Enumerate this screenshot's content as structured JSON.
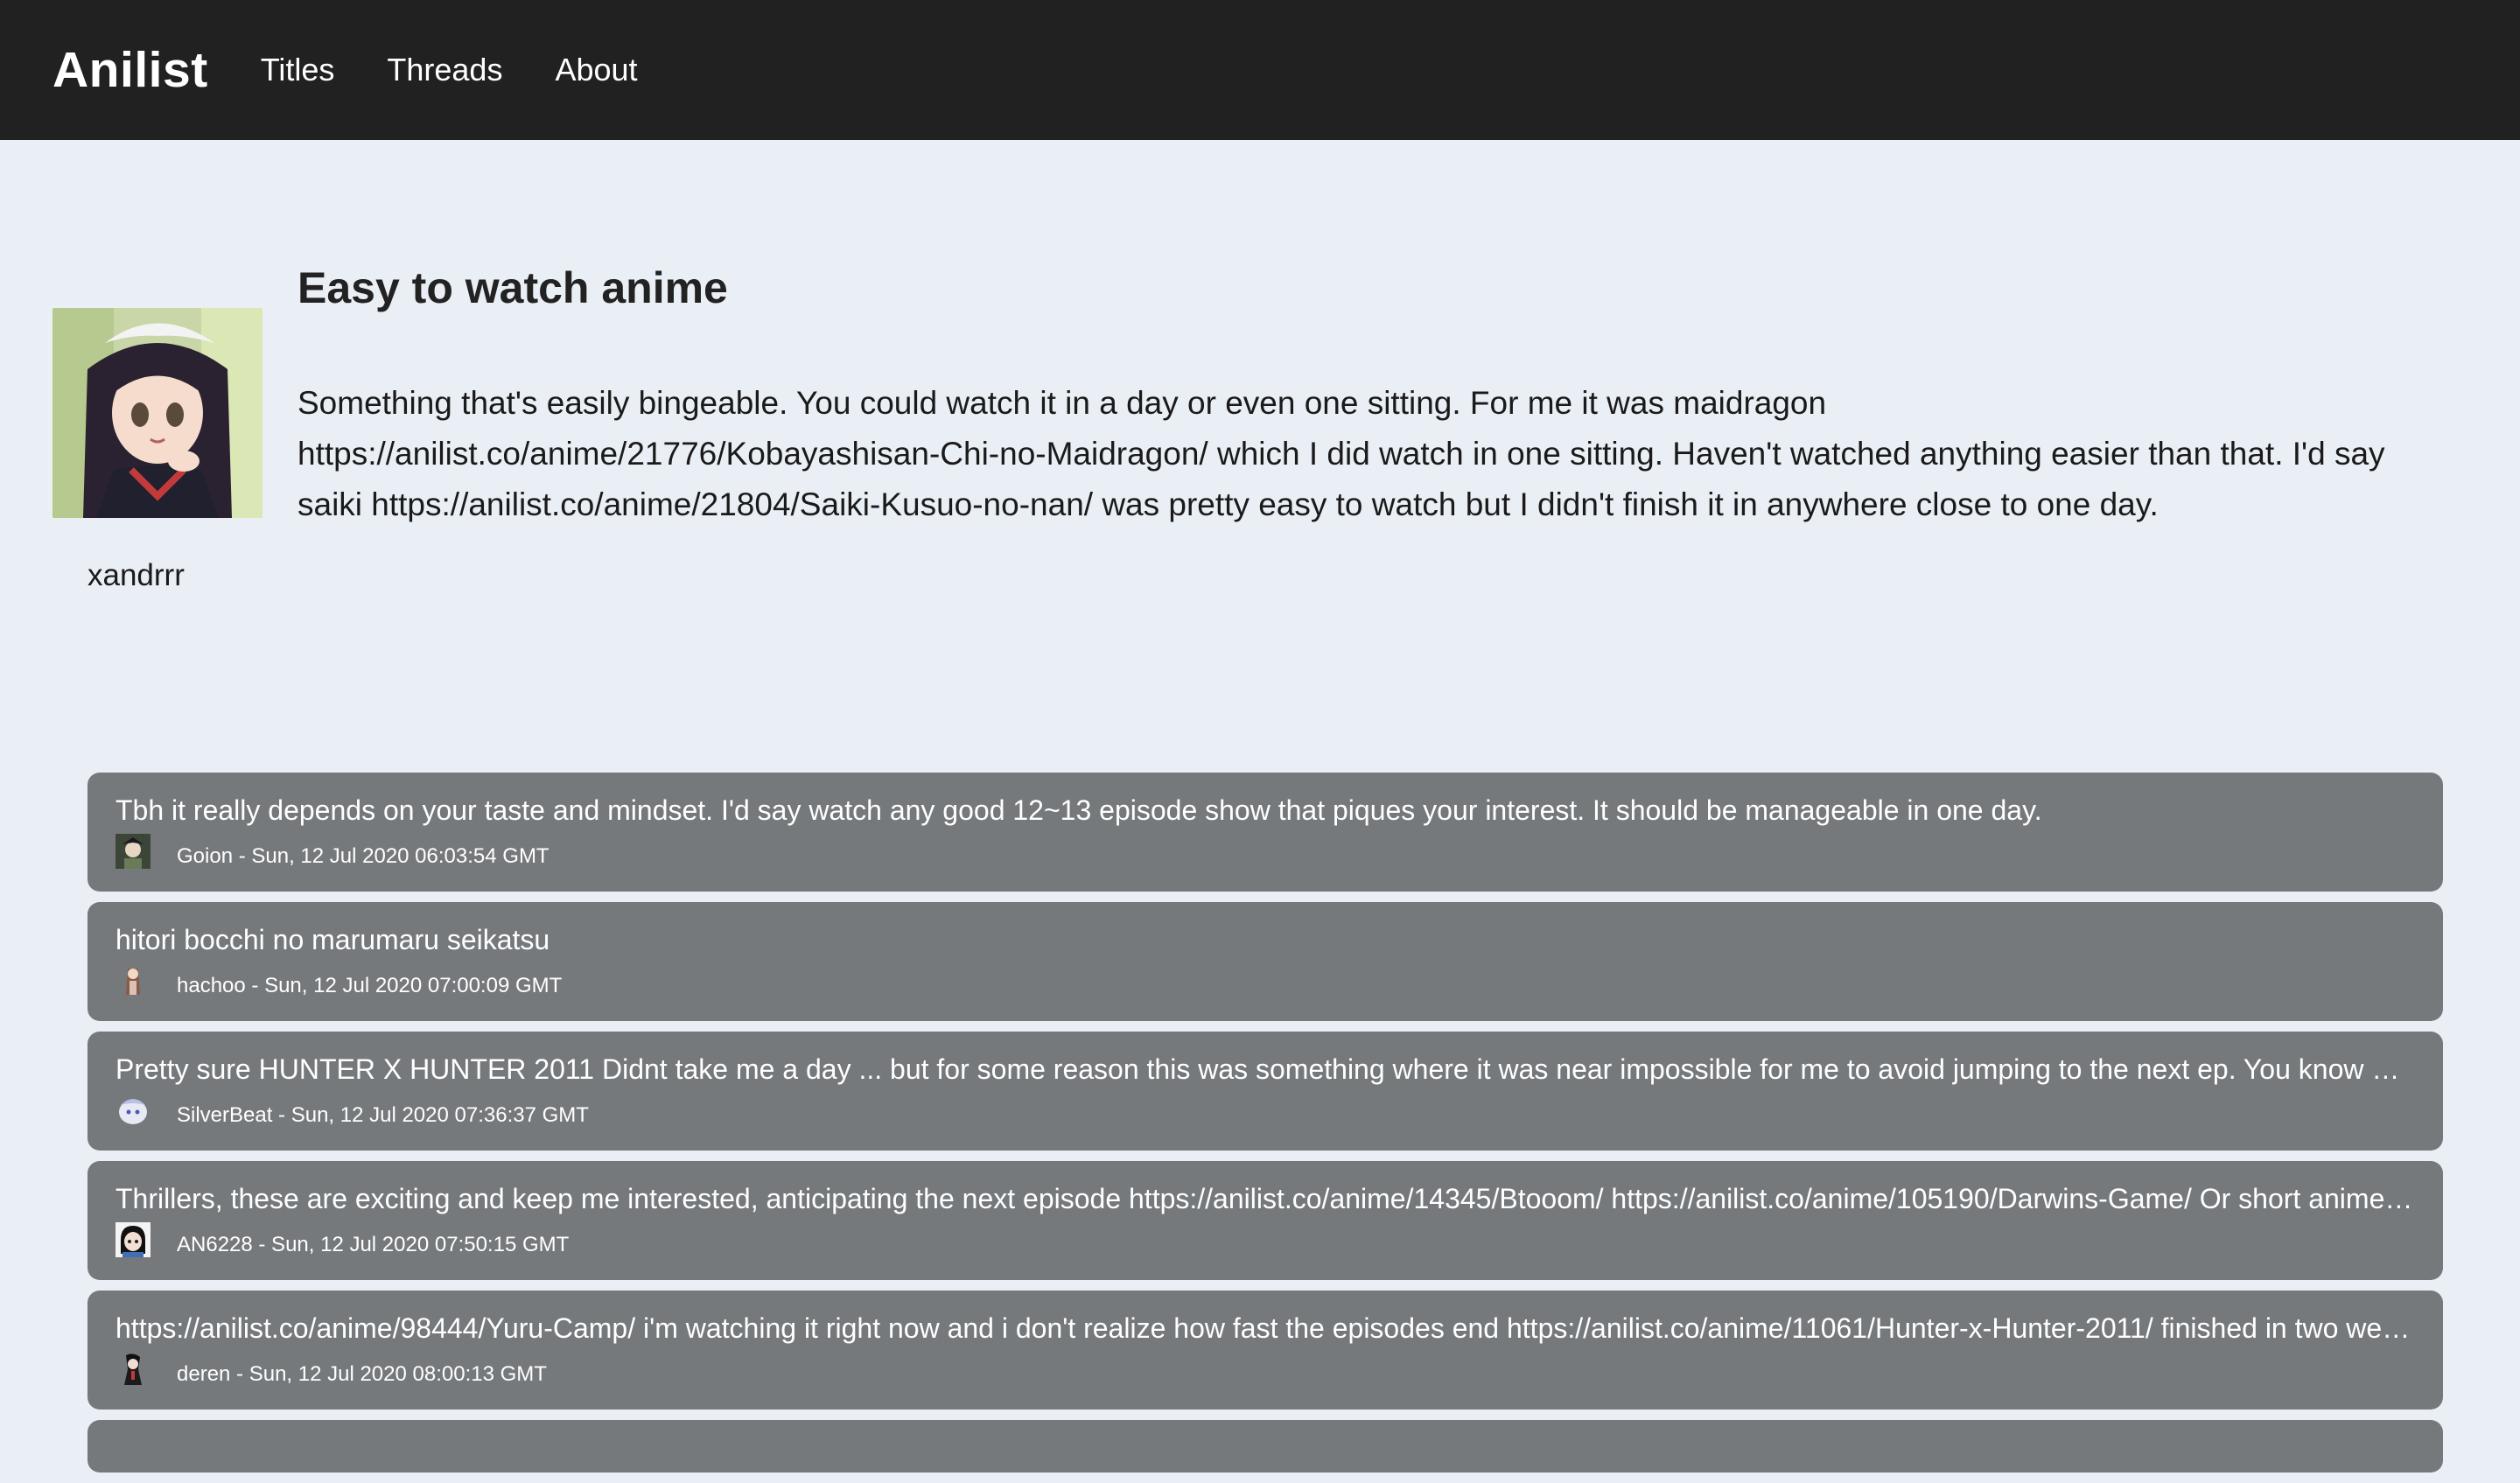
{
  "nav": {
    "brand": "Anilist",
    "links": [
      "Titles",
      "Threads",
      "About"
    ]
  },
  "thread": {
    "title": "Easy to watch anime",
    "body": "Something that's easily bingeable. You could watch it in a day or even one sitting. For me it was maidragon https://anilist.co/anime/21776/Kobayashisan-Chi-no-Maidragon/ which I did watch in one sitting. Haven't watched anything easier than that. I'd say saiki https://anilist.co/anime/21804/Saiki-Kusuo-no-nan/ was pretty easy to watch but I didn't finish it in anywhere close to one day.",
    "author": "xandrrr"
  },
  "comments": [
    {
      "text": "Tbh it really depends on your taste and mindset. I'd say watch any good 12~13 episode show that piques your interest. It should be manageable in one day.",
      "meta": "Goion - Sun, 12 Jul 2020 06:03:54 GMT"
    },
    {
      "text": "hitori bocchi no marumaru seikatsu",
      "meta": "hachoo - Sun, 12 Jul 2020 07:00:09 GMT"
    },
    {
      "text": "Pretty sure HUNTER X HUNTER 2011 Didnt take me a day ... but for some reason this was something where it was near impossible for me to avoid jumping to the next ep. You know …",
      "meta": "SilverBeat - Sun, 12 Jul 2020 07:36:37 GMT"
    },
    {
      "text": "Thrillers, these are exciting and keep me interested, anticipating the next episode https://anilist.co/anime/14345/Btooom/ https://anilist.co/anime/105190/Darwins-Game/ Or short anime…",
      "meta": "AN6228 - Sun, 12 Jul 2020 07:50:15 GMT"
    },
    {
      "text": "https://anilist.co/anime/98444/Yuru-Camp/ i'm watching it right now and i don't realize how fast the episodes end https://anilist.co/anime/11061/Hunter-x-Hunter-2011/ finished in two we…",
      "meta": "deren - Sun, 12 Jul 2020 08:00:13 GMT"
    }
  ]
}
